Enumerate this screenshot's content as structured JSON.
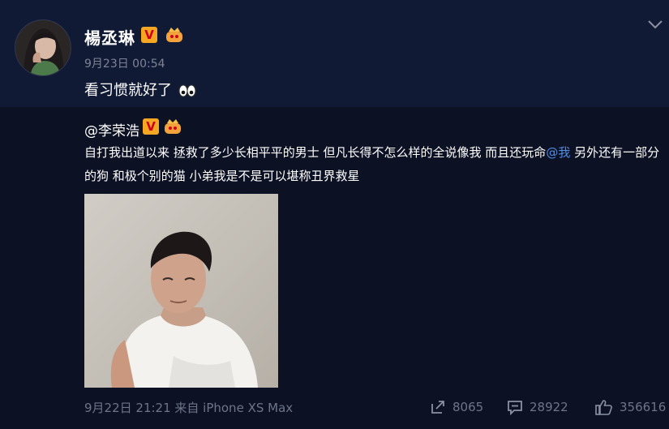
{
  "post": {
    "username": "楊丞琳",
    "timestamp": "9月23日 00:54",
    "text": "看习惯就好了",
    "emoji_icon": "eyes-emoji-icon"
  },
  "repost": {
    "username": "@李荣浩",
    "text_before_mention": "自打我出道以来 拯救了多少长相平平的男士 但凡长得不怎么样的全说像我 而且还玩命",
    "mention": "@我",
    "text_after_mention": " 另外还有一部分的狗 和极个别的猫  小弟我是不是可以堪称丑界救星",
    "meta": "9月22日 21:21 来自 iPhone XS Max",
    "repost_count": "8065",
    "comment_count": "28922",
    "like_count": "356616"
  },
  "colors": {
    "background": "#0c1124",
    "header_background": "#111a35",
    "mention": "#4f8ce6",
    "badge_v": "#f5a623"
  }
}
